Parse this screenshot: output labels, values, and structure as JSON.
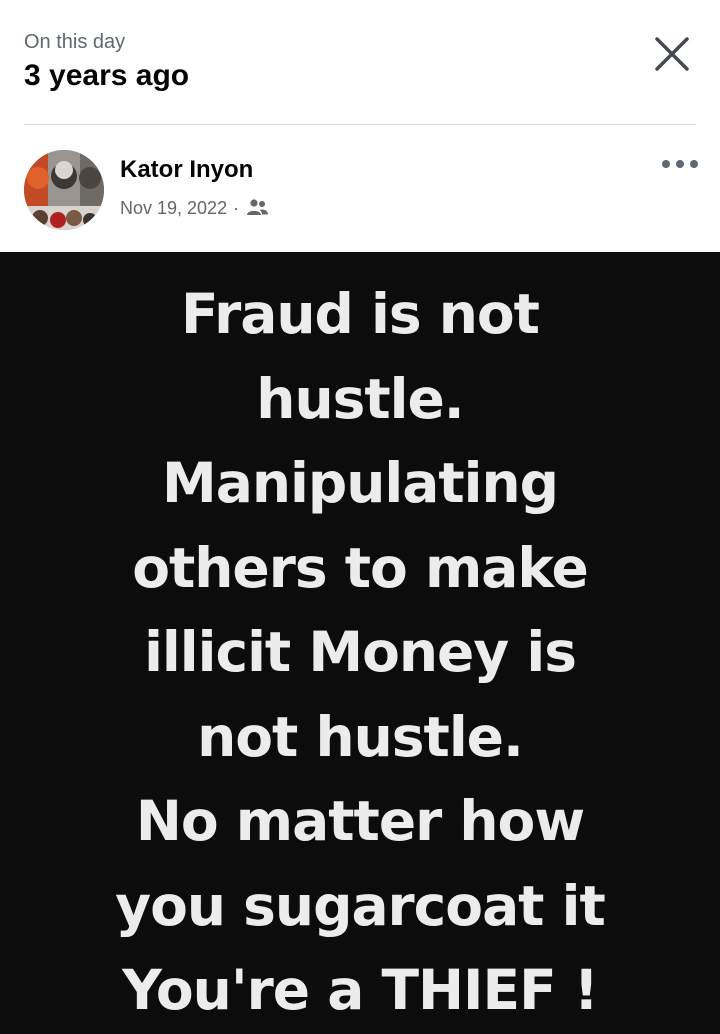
{
  "memory_header": {
    "kicker": "On this day",
    "title": "3 years ago",
    "close_icon": "close-icon"
  },
  "post": {
    "author": "Kator Inyon",
    "date": "Nov 19, 2022",
    "separator": "·",
    "audience_icon": "friends-icon",
    "more_icon": "more-horizontal-icon",
    "image_text_lines": [
      "Fraud is not",
      "hustle.",
      "Manipulating",
      "others to make",
      "illicit Money is",
      "not hustle.",
      "No matter how",
      "you sugarcoat it",
      "You're a THIEF !"
    ]
  },
  "colors": {
    "text_primary": "#050505",
    "text_secondary": "#65676b",
    "divider": "#d7d9dc",
    "image_background": "#0c0c0c",
    "image_text": "#ececec"
  }
}
